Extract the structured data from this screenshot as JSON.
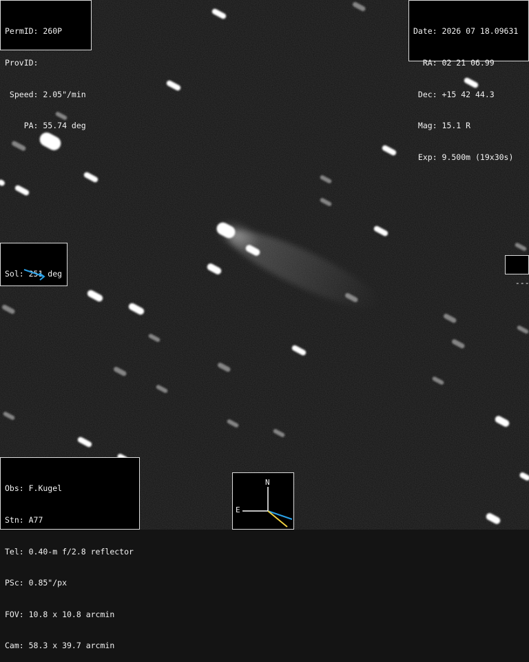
{
  "header_left": {
    "lines": [
      "PermID: 260P",
      "ProvID:",
      " Speed: 2.05\"/min",
      "    PA: 55.74 deg"
    ]
  },
  "header_right": {
    "lines": [
      "Date: 2026 07 18.09631",
      "  RA: 02 21 06.99",
      " Dec: +15 42 44.3",
      " Mag: 15.1 R",
      " Exp: 9.500m (19x30s)"
    ]
  },
  "sol_box": {
    "label": "Sol: 251 deg",
    "arrow_color": "#2aa0e6"
  },
  "right_marker": {
    "label": "---"
  },
  "observer_box": {
    "lines": [
      "Obs: F.Kugel",
      "Stn: A77",
      "Tel: 0.40-m f/2.8 reflector",
      "PSc: 0.85\"/px",
      "FOV: 10.8 x 10.8 arcmin",
      "Cam: 58.3 x 39.7 arcmin"
    ]
  },
  "compass": {
    "north_label": "N",
    "east_label": "E",
    "motion_color": "#2aa0e6",
    "sun_color": "#f0d040"
  },
  "image": {
    "background_color": "#141414",
    "star_color": "#ffffff",
    "icon": "star-trails-field"
  }
}
